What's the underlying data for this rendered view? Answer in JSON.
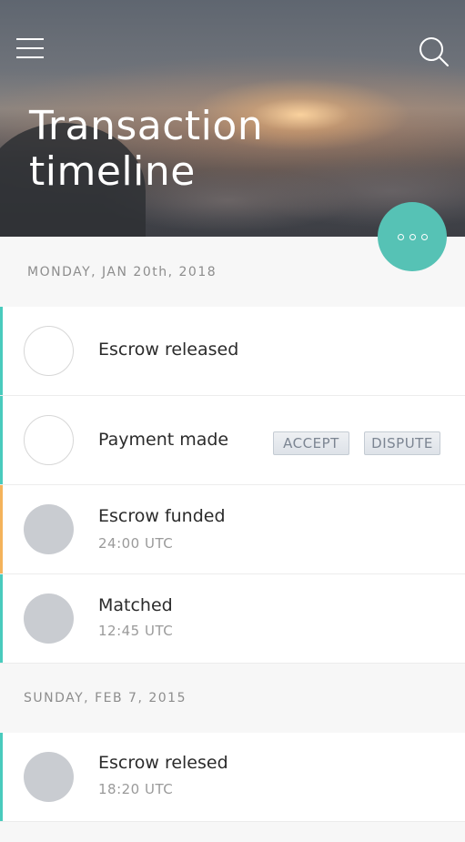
{
  "header": {
    "title_line1": "Transaction",
    "title_line2": "timeline"
  },
  "icons": {
    "menu": "hamburger-menu-icon",
    "search": "search-icon",
    "more": "more-dots-icon"
  },
  "colors": {
    "accent_teal": "#56c2b5",
    "status_teal": "#49cbbd",
    "status_orange": "#f4b35b",
    "circle_filled": "#c9ccd1"
  },
  "groups": [
    {
      "date": "MONDAY, JAN 20th, 2018",
      "items": [
        {
          "label": "Escrow released",
          "time": "",
          "state": "open",
          "status_color": "#49cbbd"
        },
        {
          "label": "Payment made",
          "time": "",
          "state": "open",
          "status_color": "#49cbbd",
          "actions": {
            "accept": "ACCEPT",
            "dispute": "DISPUTE"
          }
        },
        {
          "label": "Escrow funded",
          "time": "24:00 UTC",
          "state": "filled",
          "status_color": "#f4b35b"
        },
        {
          "label": "Matched",
          "time": "12:45 UTC",
          "state": "filled",
          "status_color": "#49cbbd"
        }
      ]
    },
    {
      "date": "SUNDAY, FEB 7, 2015",
      "items": [
        {
          "label": "Escrow relesed",
          "time": "18:20 UTC",
          "state": "filled",
          "status_color": "#49cbbd"
        }
      ]
    }
  ]
}
